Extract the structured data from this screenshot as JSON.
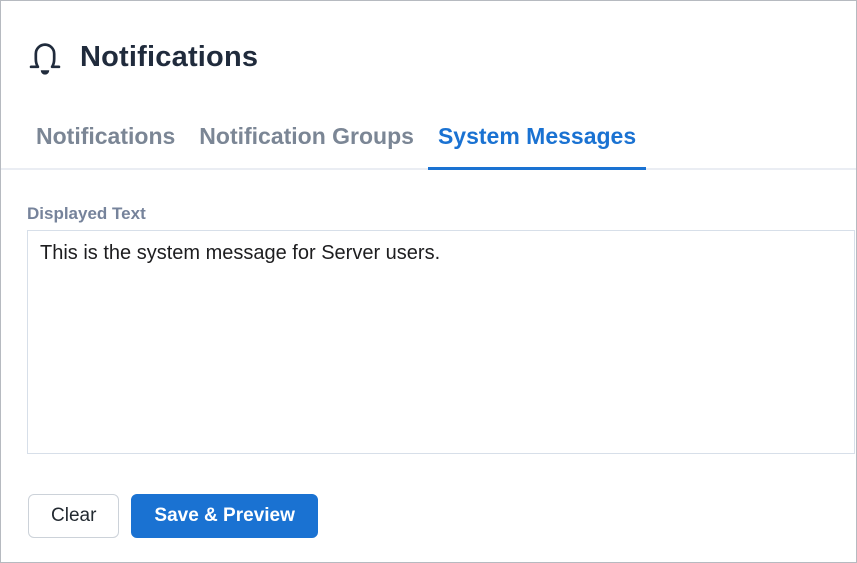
{
  "colors": {
    "accent_blue": "#1a72d2",
    "title_dark": "#202b3c",
    "tab_inactive_gray": "#7b8695",
    "label_gray": "#76839b",
    "page_border": "#b6bac0",
    "tab_divider": "#eaedf3",
    "textarea_border": "#d7dfe9"
  },
  "header": {
    "title": "Notifications",
    "icon": "bell-icon"
  },
  "tabs": [
    {
      "label": "Notifications",
      "active": false
    },
    {
      "label": "Notification Groups",
      "active": false
    },
    {
      "label": "System Messages",
      "active": true
    }
  ],
  "form": {
    "field_label": "Displayed Text",
    "textarea_value": "This is the system message for Server users."
  },
  "actions": {
    "clear_label": "Clear",
    "save_label": "Save & Preview"
  }
}
